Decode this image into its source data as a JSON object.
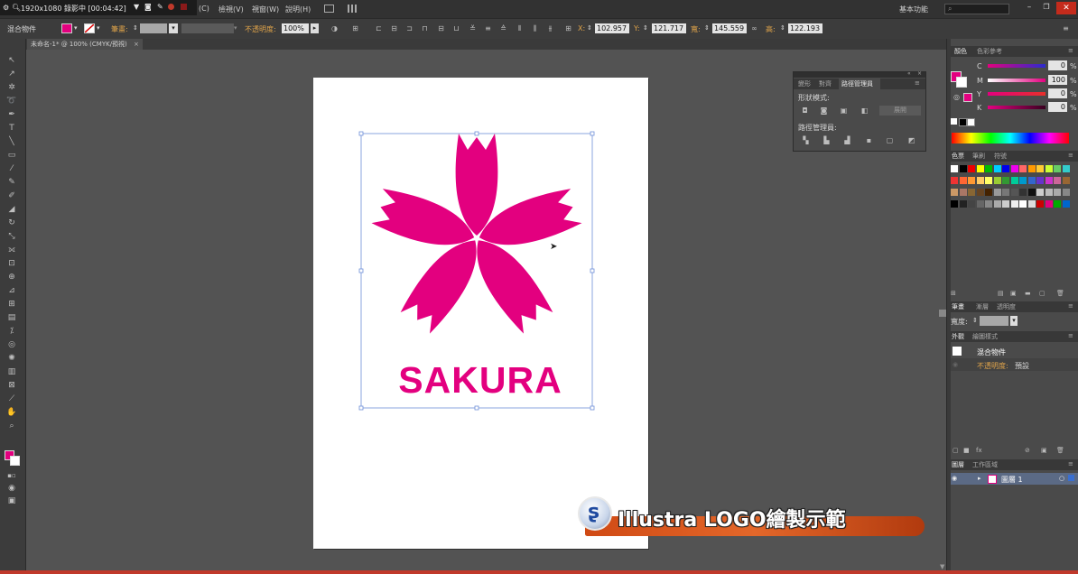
{
  "recording": {
    "label": "1920x1080  錄影中 [00:04:42]"
  },
  "menu": {
    "items": [
      "(C)",
      "檢視(V)",
      "視窗(W)",
      "說明(H)"
    ],
    "workspace": "基本功能"
  },
  "control": {
    "selection_type": "混合物件",
    "stroke_label": "筆畫:",
    "opacity_label": "不透明度:",
    "opacity_value": "100%",
    "x_label": "X:",
    "x_value": "102.957",
    "y_label": "Y:",
    "y_value": "121.717",
    "w_label": "寬:",
    "w_value": "145.559",
    "h_label": "高:",
    "h_value": "122.193"
  },
  "document": {
    "tab": "未命名-1* @ 100% (CMYK/預視)"
  },
  "artwork": {
    "text": "SAKURA",
    "color": "#e3007f"
  },
  "path_panel": {
    "tabs": [
      "變形",
      "對齊",
      "路徑管理員"
    ],
    "shape_modes": "形狀模式:",
    "expand_button": "展開",
    "pathfinders": "路徑管理員:"
  },
  "color_panel": {
    "tabs": [
      "顏色",
      "色彩參考"
    ],
    "channels": [
      {
        "name": "C",
        "value": "0"
      },
      {
        "name": "M",
        "value": "100"
      },
      {
        "name": "Y",
        "value": "0"
      },
      {
        "name": "K",
        "value": "0"
      }
    ],
    "unit": "%"
  },
  "swatches_panel": {
    "tabs": [
      "色票",
      "筆刷",
      "符號"
    ]
  },
  "stroke_panel": {
    "tabs": [
      "筆畫",
      "漸層",
      "透明度"
    ],
    "width_label": "寬度:"
  },
  "appearance_panel": {
    "tabs": [
      "外觀",
      "繪圖樣式"
    ],
    "object": "混合物件",
    "opacity_label": "不透明度:",
    "opacity_value": "預設"
  },
  "layers_panel": {
    "tabs": [
      "圖層",
      "工作區域"
    ],
    "layer_name": "圖層 1"
  },
  "banner": {
    "title": "Illustra LOGO繪製示範"
  }
}
